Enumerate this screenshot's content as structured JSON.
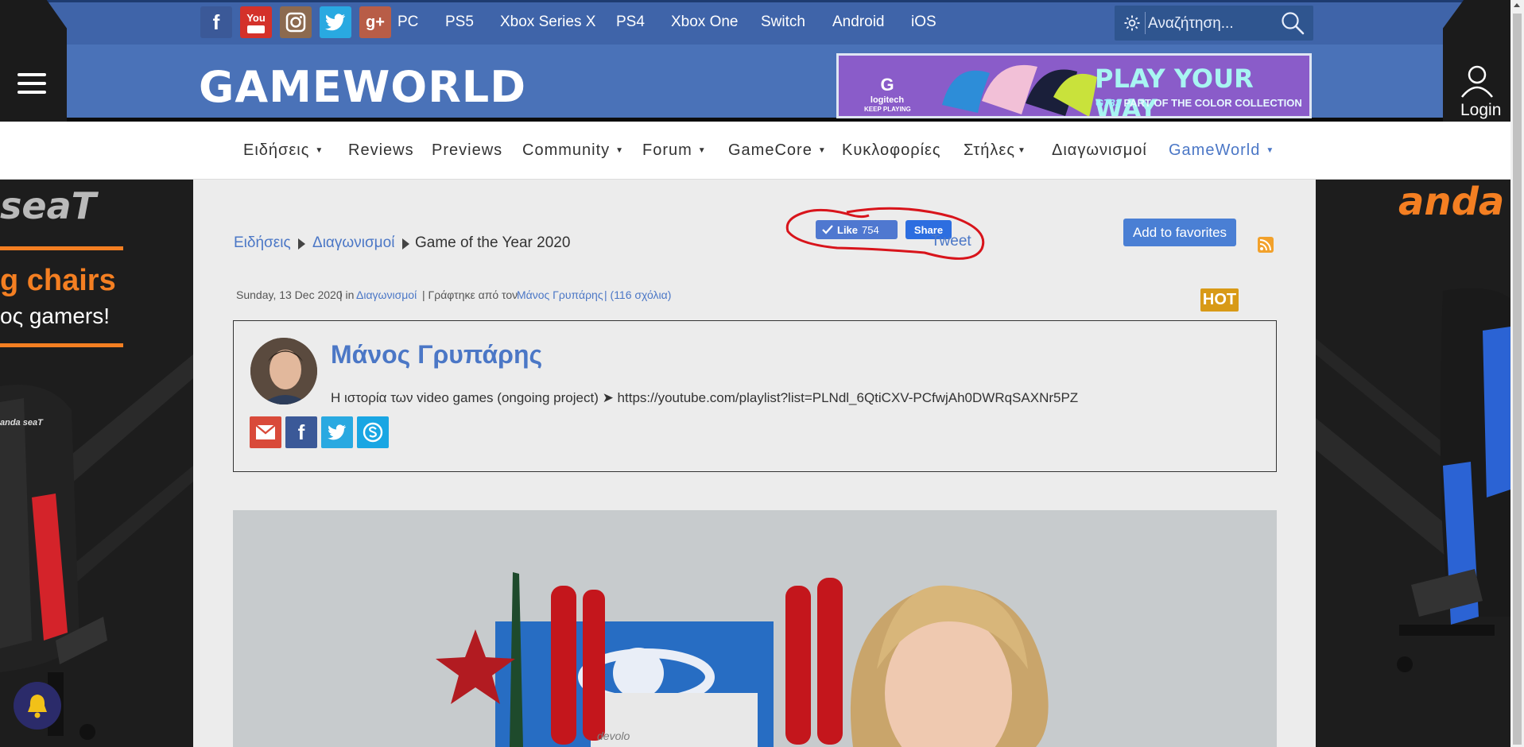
{
  "social": {
    "facebook": "f",
    "youtube": "You",
    "googleplus": "g+"
  },
  "platforms": [
    "PC",
    "PS5",
    "Xbox Series X",
    "PS4",
    "Xbox One",
    "Switch",
    "Android",
    "iOS"
  ],
  "search": {
    "placeholder": "Αναζήτηση..."
  },
  "logo": {
    "text": "GAMEWORLD"
  },
  "banner": {
    "brand": "logitech",
    "tagline": "KEEP PLAYING",
    "title": "PLAY YOUR WAY",
    "model": "G733",
    "subtitle": "PART OF THE COLOR COLLECTION"
  },
  "login": {
    "label": "Login"
  },
  "nav": [
    {
      "label": "Ειδήσεις",
      "caret": "▼"
    },
    {
      "label": "Reviews",
      "caret": ""
    },
    {
      "label": "Previews",
      "caret": ""
    },
    {
      "label": "Community",
      "caret": "▼"
    },
    {
      "label": "Forum",
      "caret": "▼"
    },
    {
      "label": "GameCore",
      "caret": "▼"
    },
    {
      "label": "Κυκλοφορίες",
      "caret": ""
    },
    {
      "label": "Στήλες",
      "caret": "▼"
    },
    {
      "label": "Διαγωνισμοί",
      "caret": ""
    },
    {
      "label": "GameWorld",
      "caret": "▼"
    }
  ],
  "breadcrumb": [
    "Ειδήσεις",
    "Διαγωνισμοί",
    "Game of the Year 2020"
  ],
  "social_widgets": {
    "like_label": "Like",
    "like_count": "754",
    "share_label": "Share",
    "tweet_label": "Tweet"
  },
  "favorites": {
    "label": "Add to favorites"
  },
  "meta": {
    "date": "Sunday, 13 Dec 2020",
    "in_prefix": "| in",
    "category": "Διαγωνισμοί",
    "by_prefix": "| Γράφτηκε από τον",
    "author": "Μάνος Γρυπάρης",
    "comments": "| (116 σχόλια)"
  },
  "hot_badge": "HOT",
  "author_box": {
    "name": "Μάνος Γρυπάρης",
    "bio": "Η ιστορία των video games (ongoing project) ➤ https://youtube.com/playlist?list=PLNdl_6QtiCXV-PCfwjAh0DWRqSAXNr5PZ",
    "share_icons": [
      "mail-icon",
      "facebook-icon",
      "twitter-icon",
      "skype-icon"
    ]
  },
  "side_ads": {
    "left_brand": "seaT",
    "left_line1": "g chairs",
    "left_line2": "ος gamers!",
    "chair_brand": "anda seaT",
    "right_brand": "anda"
  },
  "hero": {
    "box_brand": "devolo"
  },
  "colors": {
    "header_blue": "#4a72b8",
    "link_blue": "#4b77c6",
    "hot_orange": "#d89a17",
    "annotation_red": "#d8141b"
  }
}
